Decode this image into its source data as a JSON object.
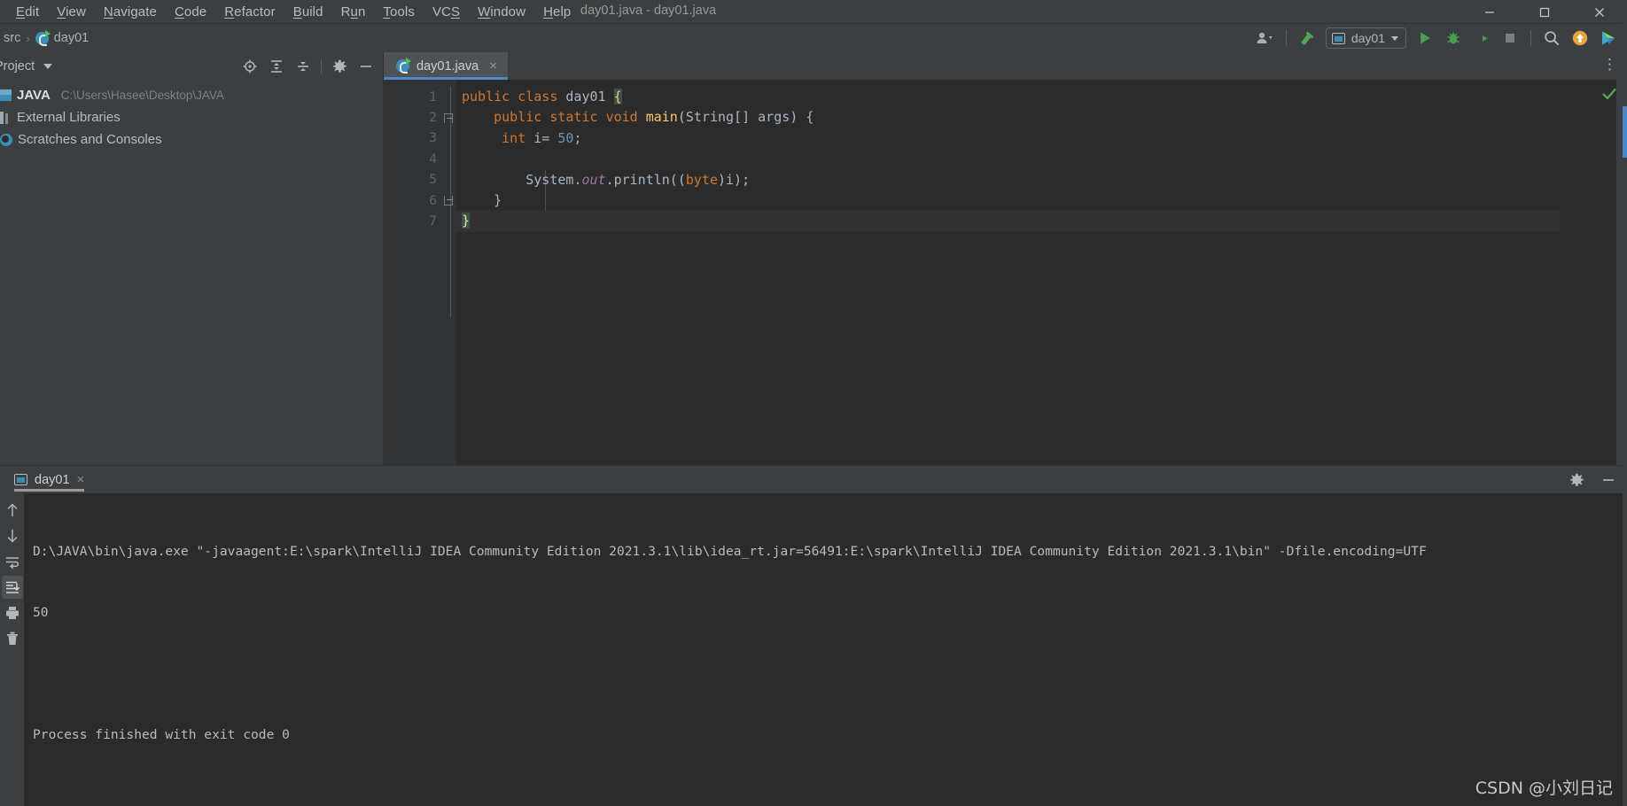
{
  "window": {
    "title": "day01.java - day01.java",
    "controls": {
      "minimize": "minimize-icon",
      "maximize": "maximize-icon",
      "close": "close-icon"
    }
  },
  "menubar": {
    "items": [
      {
        "label": "Edit",
        "mnemonic": "E"
      },
      {
        "label": "View",
        "mnemonic": "V"
      },
      {
        "label": "Navigate",
        "mnemonic": "N"
      },
      {
        "label": "Code",
        "mnemonic": "C"
      },
      {
        "label": "Refactor",
        "mnemonic": "R"
      },
      {
        "label": "Build",
        "mnemonic": "B"
      },
      {
        "label": "Run",
        "mnemonic": "u"
      },
      {
        "label": "Tools",
        "mnemonic": "T"
      },
      {
        "label": "VCS",
        "mnemonic": "S"
      },
      {
        "label": "Window",
        "mnemonic": "W"
      },
      {
        "label": "Help",
        "mnemonic": "H"
      }
    ]
  },
  "navbar": {
    "breadcrumb": [
      "src",
      "day01"
    ],
    "separator": "›",
    "toolbar": {
      "account_icon": "people-icon",
      "build_icon": "hammer-icon",
      "run_config": {
        "label": "day01",
        "icon": "run-configuration-icon"
      },
      "run_icon": "play-icon",
      "debug_icon": "bug-icon",
      "coverage_icon": "run-with-coverage-icon",
      "stop_icon": "stop-icon",
      "search_icon": "search-icon",
      "update_icon": "update-project-icon",
      "feedback_icon": "ide-feature-trainer-icon"
    }
  },
  "sidebar": {
    "title": "Project",
    "tools": [
      {
        "name": "select-opened-file-icon"
      },
      {
        "name": "expand-all-icon"
      },
      {
        "name": "collapse-all-icon"
      },
      {
        "name": "settings-gear-icon"
      },
      {
        "name": "hide-panel-icon"
      }
    ],
    "tree": [
      {
        "label": "JAVA",
        "path": "C:\\Users\\Hasee\\Desktop\\JAVA",
        "icon": "module-icon",
        "bold": true
      },
      {
        "label": "External Libraries",
        "path": "",
        "icon": "library-icon",
        "bold": false
      },
      {
        "label": "Scratches and Consoles",
        "path": "",
        "icon": "scratches-icon",
        "bold": false
      }
    ]
  },
  "editor": {
    "tab": {
      "label": "day01.java",
      "icon": "java-class-icon",
      "close": "×"
    },
    "more_menu": "⋮",
    "inspection_status": "ok-checkmark",
    "gutter_lines": [
      "1",
      "2",
      "3",
      "4",
      "5",
      "6",
      "7"
    ],
    "code_lines": [
      {
        "n": 1,
        "text": "public class day01 {"
      },
      {
        "n": 2,
        "text": "    public static void main(String[] args) {"
      },
      {
        "n": 3,
        "text": "     int i= 50;"
      },
      {
        "n": 4,
        "text": ""
      },
      {
        "n": 5,
        "text": "        System.out.println((byte)i);"
      },
      {
        "n": 6,
        "text": "    }"
      },
      {
        "n": 7,
        "text": "}"
      }
    ]
  },
  "runpanel": {
    "tab": {
      "label": "day01",
      "icon": "run-configuration-icon",
      "close": "×"
    },
    "tools": [
      {
        "name": "settings-gear-icon"
      },
      {
        "name": "hide-panel-icon"
      }
    ],
    "sidebar_buttons": [
      {
        "name": "up-arrow-icon",
        "active": false
      },
      {
        "name": "down-arrow-icon",
        "active": false
      },
      {
        "name": "soft-wrap-icon",
        "active": false
      },
      {
        "name": "scroll-to-end-icon",
        "active": true
      },
      {
        "name": "print-icon",
        "active": false
      },
      {
        "name": "trash-icon",
        "active": false
      }
    ],
    "console_lines": [
      "D:\\JAVA\\bin\\java.exe \"-javaagent:E:\\spark\\IntelliJ IDEA Community Edition 2021.3.1\\lib\\idea_rt.jar=56491:E:\\spark\\IntelliJ IDEA Community Edition 2021.3.1\\bin\" -Dfile.encoding=UTF",
      "50",
      "",
      "Process finished with exit code 0"
    ]
  },
  "watermark": "CSDN @小刘日记",
  "colors": {
    "chrome_bg": "#3c3f41",
    "editor_bg": "#2b2b2b",
    "gutter_bg": "#313335",
    "tab_active": "#4e5254",
    "accent_blue": "#4a88c7",
    "keyword_orange": "#cc7832",
    "method_yellow": "#ffc66d",
    "number_blue": "#6897bb",
    "static_purple": "#9876aa",
    "text_grey": "#a9b7c6",
    "run_green": "#499c54"
  }
}
